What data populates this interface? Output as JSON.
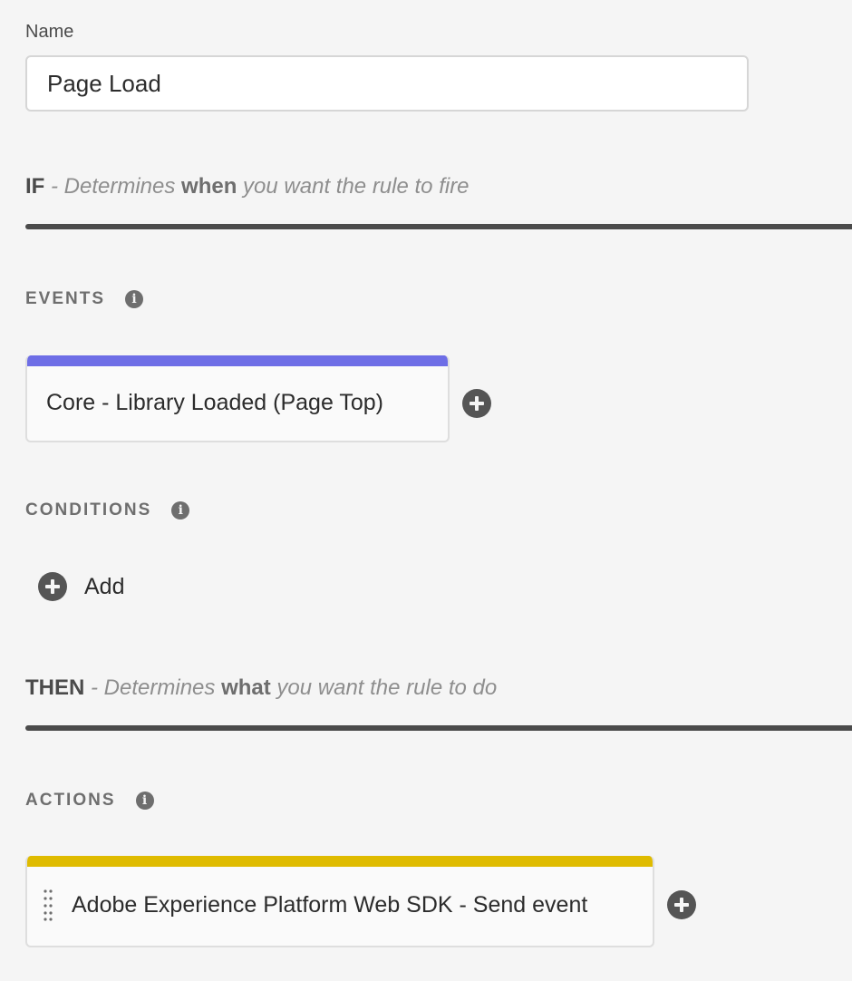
{
  "name_field": {
    "label": "Name",
    "value": "Page Load"
  },
  "if_section": {
    "keyword": "IF",
    "desc_prefix": "- Determines ",
    "desc_strong": "when",
    "desc_suffix": " you want the rule to fire"
  },
  "events": {
    "label": "EVENTS",
    "info_icon": "info-icon",
    "items": [
      {
        "label": "Core - Library Loaded (Page Top)",
        "accent": "#6e6ee6"
      }
    ]
  },
  "conditions": {
    "label": "CONDITIONS",
    "info_icon": "info-icon",
    "add_label": "Add"
  },
  "then_section": {
    "keyword": "THEN",
    "desc_prefix": "- Determines ",
    "desc_strong": "what",
    "desc_suffix": " you want the rule to do"
  },
  "actions": {
    "label": "ACTIONS",
    "info_icon": "info-icon",
    "items": [
      {
        "label": "Adobe Experience Platform Web SDK - Send event",
        "accent": "#dfbb00"
      }
    ]
  },
  "colors": {
    "background": "#f5f5f5",
    "divider": "#4b4b4b",
    "plus_button": "#555555"
  }
}
